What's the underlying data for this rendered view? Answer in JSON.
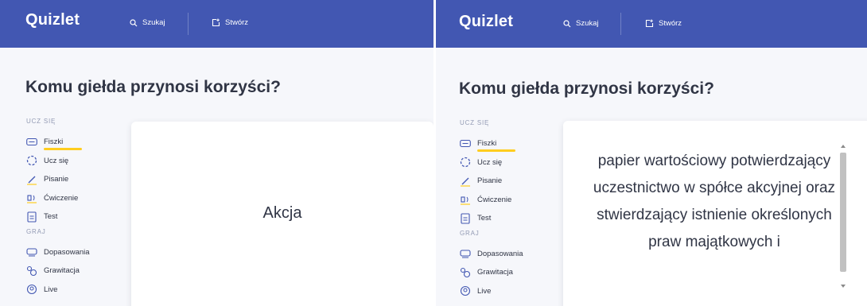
{
  "colors": {
    "header": "#4257b2",
    "underline": "#ffcd1f",
    "text": "#303545",
    "muted": "#939bb4"
  },
  "screens": [
    {
      "logo": "Quizlet",
      "nav": {
        "search": "Szukaj",
        "create": "Stwórz"
      },
      "title": "Komu giełda przynosi korzyści?",
      "sections": {
        "learn": "UCZ SIĘ",
        "play": "GRAJ"
      },
      "learn_items": [
        "Fiszki",
        "Ucz się",
        "Pisanie",
        "Ćwiczenie",
        "Test"
      ],
      "play_items": [
        "Dopasowania",
        "Grawitacja",
        "Live"
      ],
      "card_text": "Akcja"
    },
    {
      "logo": "Quizlet",
      "nav": {
        "search": "Szukaj",
        "create": "Stwórz"
      },
      "title": "Komu giełda przynosi korzyści?",
      "sections": {
        "learn": "UCZ SIĘ",
        "play": "GRAJ"
      },
      "learn_items": [
        "Fiszki",
        "Ucz się",
        "Pisanie",
        "Ćwiczenie",
        "Test"
      ],
      "play_items": [
        "Dopasowania",
        "Grawitacja",
        "Live"
      ],
      "card_text": "papier wartościowy potwierdzający uczestnictwo w spółce akcyjnej oraz stwierdzający istnienie określonych praw majątkowych i"
    }
  ]
}
